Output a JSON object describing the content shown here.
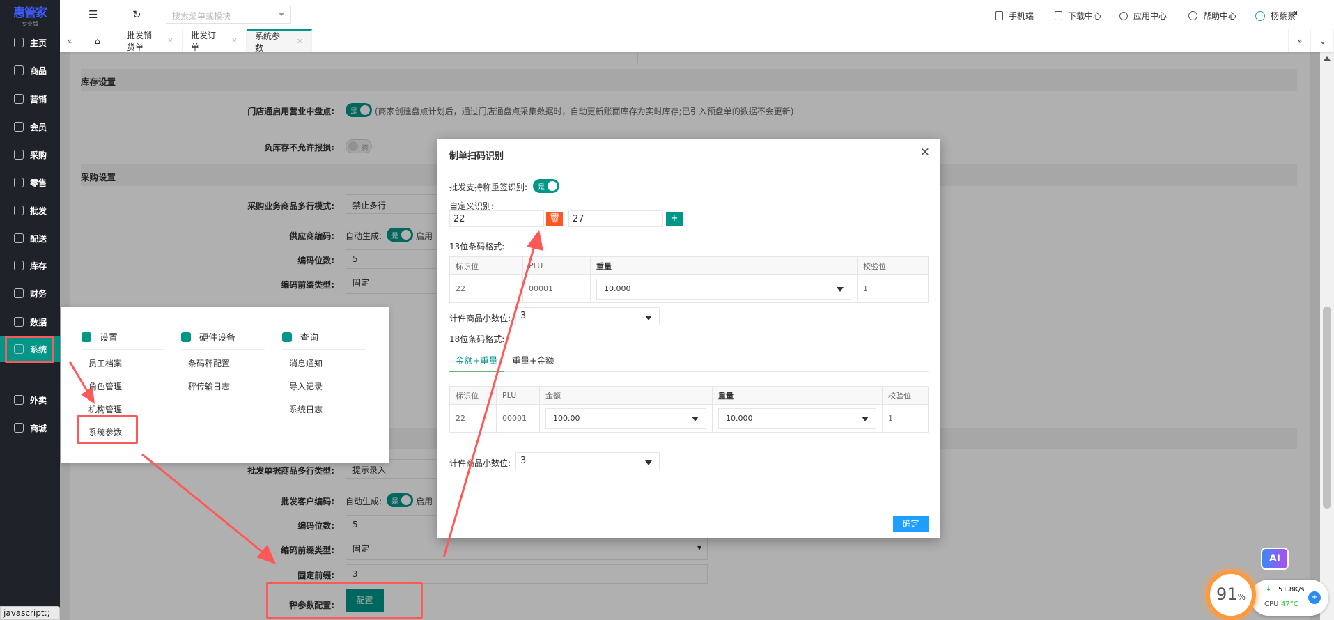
{
  "logo": {
    "title": "惠管家",
    "subtitle": "专业版"
  },
  "sidebar": {
    "items": [
      {
        "label": "主页",
        "icon": "home-icon"
      },
      {
        "label": "商品",
        "icon": "box-icon"
      },
      {
        "label": "营销",
        "icon": "chart-icon"
      },
      {
        "label": "会员",
        "icon": "heart-icon"
      },
      {
        "label": "采购",
        "icon": "cart-icon"
      },
      {
        "label": "零售",
        "icon": "bag-icon"
      },
      {
        "label": "批发",
        "icon": "building-icon"
      },
      {
        "label": "配送",
        "icon": "truck-icon"
      },
      {
        "label": "库存",
        "icon": "inventory-icon"
      },
      {
        "label": "财务",
        "icon": "finance-icon"
      },
      {
        "label": "数据",
        "icon": "data-icon"
      },
      {
        "label": "系统",
        "icon": "settings-icon",
        "active": true
      },
      {
        "label": "外卖",
        "icon": "delivery-icon"
      },
      {
        "label": "商城",
        "icon": "store-icon"
      }
    ]
  },
  "header": {
    "search_placeholder": "搜索菜单或模块",
    "links": [
      "手机端",
      "下载中心",
      "应用中心",
      "帮助中心"
    ],
    "user": "杨蔡蔡"
  },
  "tabs": [
    {
      "label": "批发销货单"
    },
    {
      "label": "批发订单"
    },
    {
      "label": "系统参数",
      "active": true
    }
  ],
  "form": {
    "inventory_section": "库存设置",
    "store_count_label": "门店通启用营业中盘点:",
    "store_count_toggle": "是",
    "store_count_note": "(商家创建盘点计划后，通过门店通盘点采集数据时，自动更新账面库存为实时库存;已引入预盘单的数据不会更新)",
    "neg_stock_label": "负库存不允许报损:",
    "neg_stock_toggle": "否",
    "purchase_section": "采购设置",
    "purchase_multi_label": "采购业务商品多行模式:",
    "purchase_multi_value": "禁止多行",
    "supplier_code_label": "供应商编码:",
    "auto_gen_label": "自动生成:",
    "auto_gen_toggle": "是",
    "enable_text": "启用",
    "code_digits_label": "编码位数:",
    "code_digits_value": "5",
    "prefix_type_label": "编码前缀类型:",
    "prefix_type_value": "固定",
    "wholesale_multi_label": "批发单据商品多行类型:",
    "wholesale_multi_value": "提示录入",
    "customer_code_label": "批发客户编码:",
    "auto_gen_label2": "自动生成:",
    "auto_gen_toggle2": "是",
    "enable_text2": "启用",
    "code_digits_label2": "编码位数:",
    "code_digits_value2": "5",
    "prefix_type_label2": "编码前缀类型:",
    "prefix_type_value2": "固定",
    "fixed_prefix_label": "固定前缀:",
    "fixed_prefix_value": "3",
    "scale_config_label": "秤参数配置:",
    "scale_config_button": "配置"
  },
  "popup": {
    "columns": [
      {
        "title": "设置",
        "icon": "gear-icon",
        "items": [
          "员工档案",
          "角色管理",
          "机构管理",
          "系统参数"
        ]
      },
      {
        "title": "硬件设备",
        "icon": "cash-register-icon",
        "items": [
          "条码秤配置",
          "秤传输日志"
        ]
      },
      {
        "title": "查询",
        "icon": "search-icon",
        "items": [
          "消息通知",
          "导入记录",
          "系统日志"
        ]
      }
    ]
  },
  "modal": {
    "title": "制单扫码识别",
    "weight_label_label": "批发支持称重签识别:",
    "weight_label_toggle": "是",
    "custom_id_label": "自定义识别:",
    "custom_ids": [
      "22",
      "27"
    ],
    "code13_label": "13位条码格式:",
    "table13": {
      "headers": [
        "标识位",
        "PLU",
        "重量",
        "校验位"
      ],
      "row": [
        "22",
        "00001",
        "10.000",
        "1"
      ]
    },
    "decimal_label": "计件商品小数位:",
    "decimal_value": "3",
    "code18_label": "18位条码格式:",
    "code18_tabs": [
      {
        "label": "金额+重量",
        "active": true
      },
      {
        "label": "重量+金额"
      }
    ],
    "table18": {
      "headers": [
        "标识位",
        "PLU",
        "金额",
        "重量",
        "校验位"
      ],
      "row": [
        "22",
        "00001",
        "100.00",
        "10.000",
        "1"
      ]
    },
    "decimal_label2": "计件商品小数位:",
    "decimal_value2": "3",
    "ok": "确定"
  },
  "status_bar": "javascript:;",
  "widget": {
    "percent": "91",
    "percent_unit": "%",
    "speed": "51.8K/s",
    "cpu_label": "CPU",
    "cpu_temp": "47°C",
    "ai": "AI"
  },
  "colors": {
    "accent": "#009688",
    "danger": "#ff5722",
    "primary": "#1e9fff",
    "annotation": "#ff5858"
  }
}
